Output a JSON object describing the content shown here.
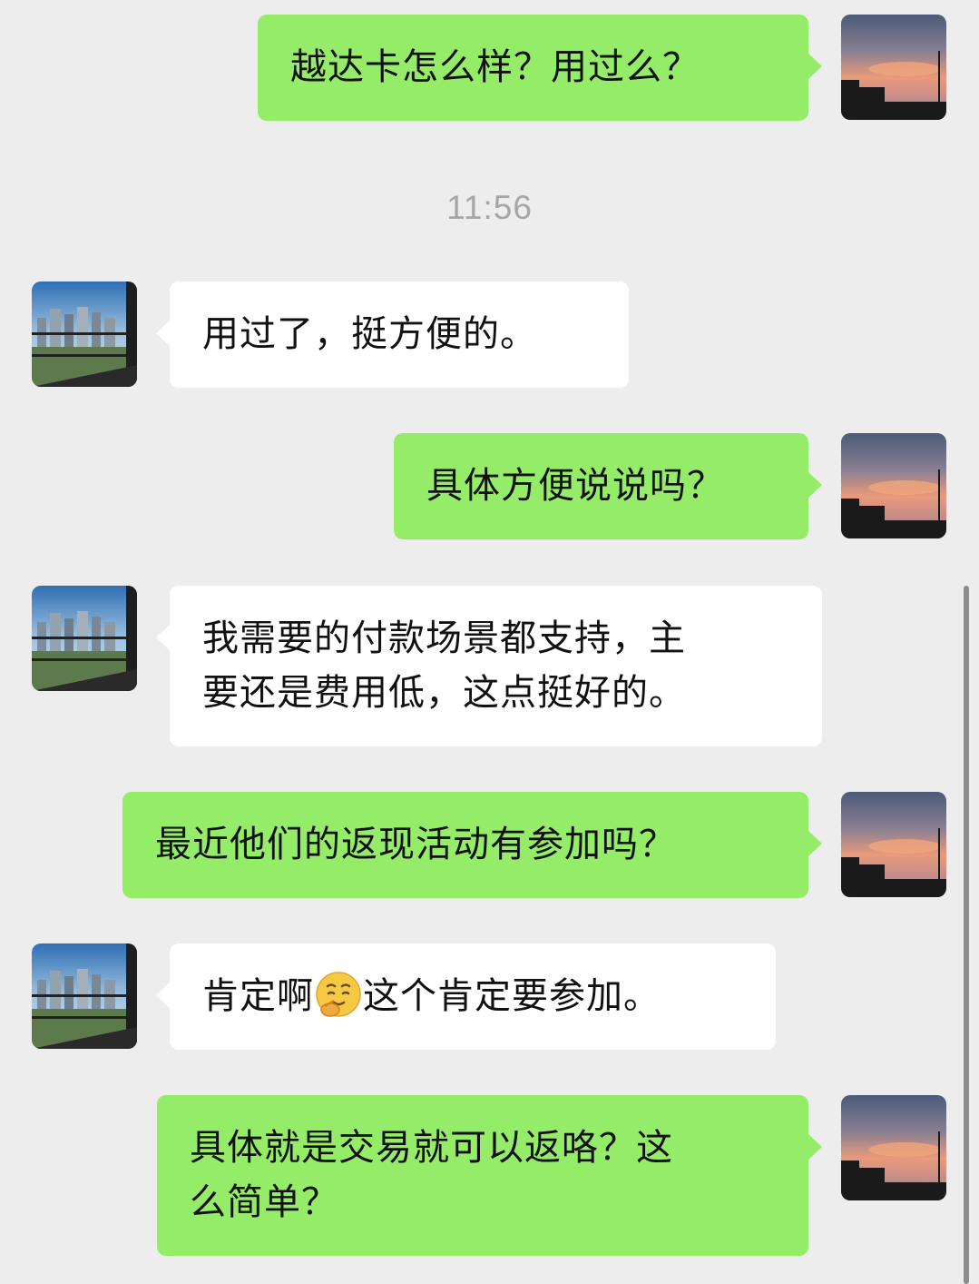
{
  "timestamp": "11:56",
  "messages": [
    {
      "side": "right",
      "text": "越达卡怎么样？用过么？",
      "avatar": "sunset-avatar"
    },
    {
      "side": "left",
      "text": "用过了，挺方便的。",
      "avatar": "city-avatar"
    },
    {
      "side": "right",
      "text": "具体方便说说吗？",
      "avatar": "sunset-avatar"
    },
    {
      "side": "left",
      "text": "我需要的付款场景都支持，主\n要还是费用低，这点挺好的。",
      "avatar": "city-avatar"
    },
    {
      "side": "right",
      "text": "最近他们的返现活动有参加吗？",
      "avatar": "sunset-avatar"
    },
    {
      "side": "left",
      "text_before": "肯定啊",
      "emoji": "thinking-face-emoji",
      "text_after": "这个肯定要参加。",
      "avatar": "city-avatar"
    },
    {
      "side": "right",
      "text": "具体就是交易就可以返咯？这\n么简单？",
      "avatar": "sunset-avatar"
    }
  ],
  "colors": {
    "background": "#ededed",
    "outgoing_bubble": "#95ec69",
    "incoming_bubble": "#ffffff",
    "timestamp_text": "#a6a6a6"
  }
}
